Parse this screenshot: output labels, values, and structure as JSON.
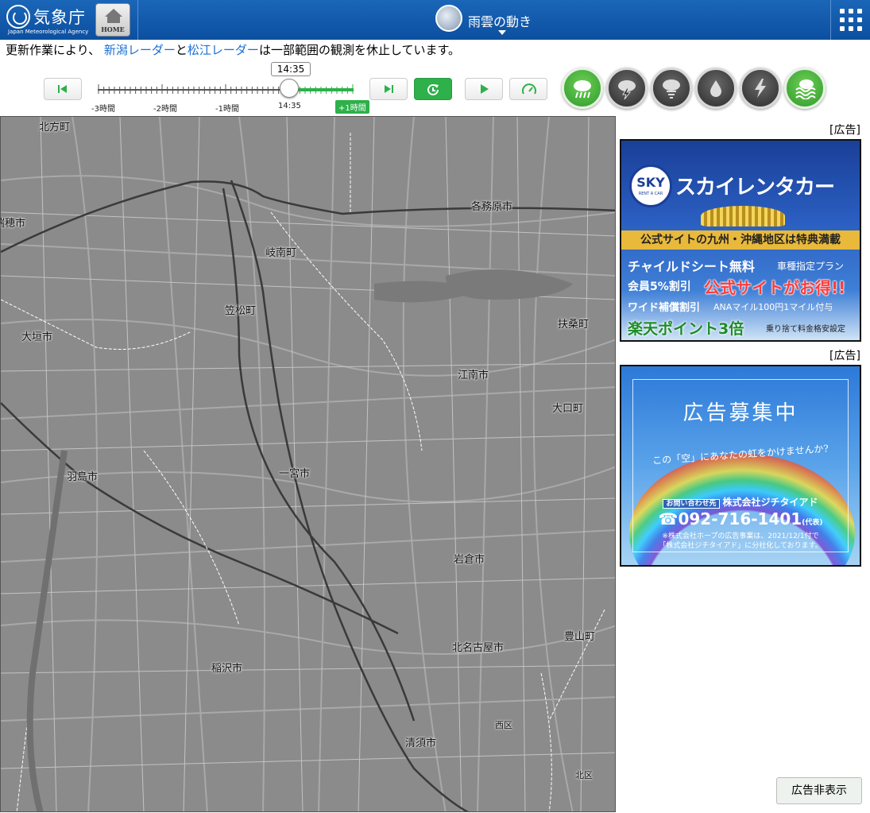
{
  "header": {
    "logo_text": "気象庁",
    "logo_sub": "Japan Meteorological Agency",
    "home_label": "HOME",
    "title": "雨雲の動き"
  },
  "notice": {
    "prefix": "更新作業により、",
    "link1": "新潟レーダー",
    "joiner": "と",
    "link2": "松江レーダー",
    "suffix": "は一部範囲の観測を休止しています。"
  },
  "timeline": {
    "current_time": "14:35",
    "labels": [
      "-3時間",
      "-2時間",
      "-1時間",
      "14:35",
      "+1時間"
    ],
    "position_fraction": 0.75
  },
  "layers": [
    {
      "name": "rain-cloud",
      "active": true
    },
    {
      "name": "thunder",
      "active": false
    },
    {
      "name": "tornado",
      "active": false
    },
    {
      "name": "rainfall",
      "active": false
    },
    {
      "name": "lightning",
      "active": false
    },
    {
      "name": "rain-snow",
      "active": true
    }
  ],
  "map": {
    "places": [
      {
        "name": "北方町"
      },
      {
        "name": "各務原市"
      },
      {
        "name": "瑞穂市"
      },
      {
        "name": "岐南町"
      },
      {
        "name": "笠松町"
      },
      {
        "name": "大垣市"
      },
      {
        "name": "扶桑町"
      },
      {
        "name": "江南市"
      },
      {
        "name": "大口町"
      },
      {
        "name": "羽島市"
      },
      {
        "name": "一宮市"
      },
      {
        "name": "岩倉市"
      },
      {
        "name": "豊山町"
      },
      {
        "name": "北名古屋市"
      },
      {
        "name": "稲沢市"
      },
      {
        "name": "西区"
      },
      {
        "name": "清須市"
      },
      {
        "name": "北区"
      }
    ]
  },
  "ads": {
    "tag": "[広告]",
    "ad1": {
      "brand_short": "SKY",
      "brand_sub": "RENT A CAR",
      "brand_name": "スカイレンタカー",
      "band": "公式サイトの九州・沖縄地区は特典満載",
      "line1": "チャイルドシート無料",
      "line1_side": "車種指定プラン",
      "line2": "会員5%割引",
      "headline": "公式サイトがお得!!",
      "line3": "ワイド補償割引",
      "line3_side": "ANAマイル100円1マイル付与",
      "line4": "楽天ポイント3倍",
      "line4_side": "乗り捨て料金格安設定"
    },
    "ad2": {
      "heading": "広告募集中",
      "sub": "この「空」にあなたの虹をかけませんか?",
      "contact_box": "お問い合わせ先",
      "contact_name": "株式会社ジチタイアド",
      "phone": "☎092-716-1401",
      "phone_note": "(代表)",
      "note1": "※株式会社ホープの広告事業は、2021/12/1付で",
      "note2": "「株式会社ジチタイアド」に分社化しております。"
    },
    "hide_label": "広告非表示"
  }
}
